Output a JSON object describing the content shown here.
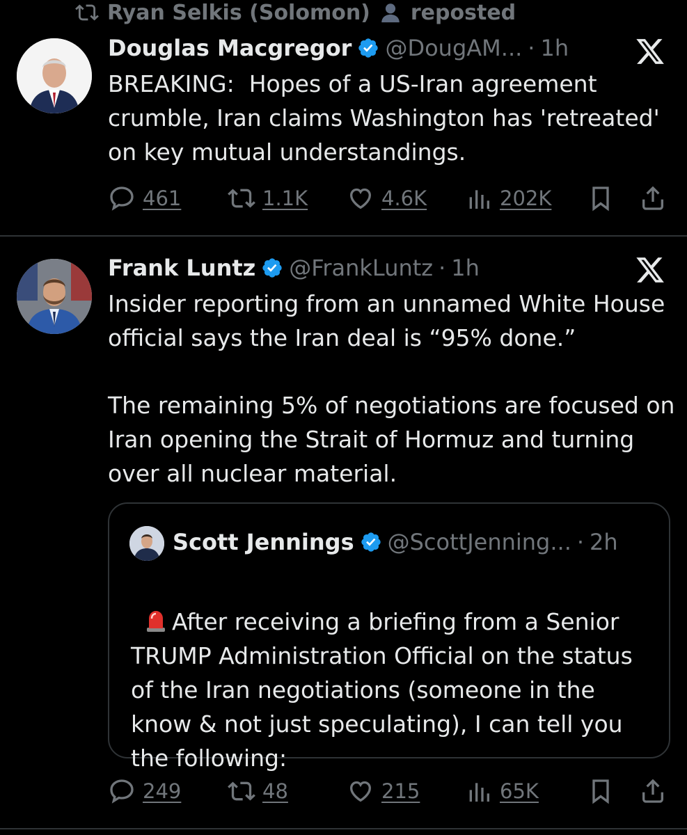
{
  "repost_header": {
    "reposter": "Ryan Selkis (Solomon)",
    "suffix": "reposted"
  },
  "tweets": [
    {
      "name": "Douglas Macgregor",
      "handle": "@DougAM...",
      "time": "1h",
      "text": "BREAKING:  Hopes of a US-Iran agreement crumble, Iran claims Washington has 'retreated' on key mutual understandings.",
      "replies": "461",
      "reposts": "1.1K",
      "likes": "4.6K",
      "views": "202K"
    },
    {
      "name": "Frank Luntz",
      "handle": "@FrankLuntz",
      "time": "1h",
      "text_p1": "Insider reporting from an unnamed White House official says the Iran deal is “95% done.”",
      "text_p2": "The remaining 5% of negotiations are focused on Iran opening the Strait of Hormuz and turning over all nuclear material.",
      "quote": {
        "name": "Scott Jennings",
        "handle": "@ScottJenning...",
        "time": "2h",
        "text": "After receiving a briefing from a Senior TRUMP Administration Official on the status of the Iran negotiations (someone in the know & not just speculating), I can tell you the following:"
      },
      "replies": "249",
      "reposts": "48",
      "likes": "215",
      "views": "65K"
    }
  ],
  "colors": {
    "background": "#000000",
    "text": "#e7e9ea",
    "muted": "#71767b",
    "verified": "#1d9bf0",
    "border": "#2f3336"
  }
}
